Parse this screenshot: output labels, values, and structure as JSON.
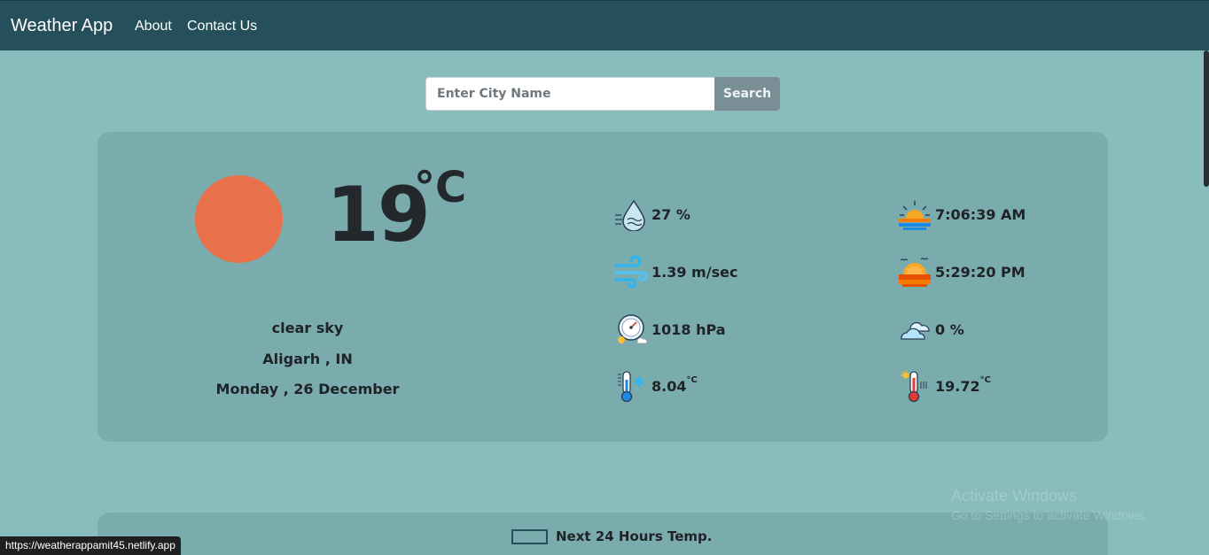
{
  "nav": {
    "brand": "Weather App",
    "links": [
      "About",
      "Contact Us"
    ]
  },
  "search": {
    "placeholder": "Enter City Name",
    "value": "",
    "button_label": "Search"
  },
  "current": {
    "temperature": "19",
    "unit": "°C",
    "description": "clear sky",
    "location": "Aligarh , IN",
    "date": "Monday , 26 December",
    "icon": "sun-icon",
    "icon_color": "#e8704b"
  },
  "stats": {
    "humidity": {
      "value": "27 %",
      "icon": "humidity-icon"
    },
    "sunrise": {
      "value": "7:06:39 AM",
      "icon": "sunrise-icon"
    },
    "wind": {
      "value": "1.39 m/sec",
      "icon": "wind-icon"
    },
    "sunset": {
      "value": "5:29:20 PM",
      "icon": "sunset-icon"
    },
    "pressure": {
      "value": "1018 hPa",
      "icon": "pressure-gauge-icon"
    },
    "clouds": {
      "value": "0 %",
      "icon": "cloud-icon"
    },
    "min_temp": {
      "value": "8.04",
      "unit": "°C",
      "icon": "cold-thermometer-icon"
    },
    "max_temp": {
      "value": "19.72",
      "unit": "°C",
      "icon": "hot-thermometer-icon"
    }
  },
  "forecast": {
    "legend_label": "Next 24 Hours Temp."
  },
  "status_bar": {
    "url": "https://weatherappamit45.netlify.app"
  },
  "watermark": {
    "line1": "Activate Windows",
    "line2": "Go to Settings to activate Windows."
  },
  "colors": {
    "navbar": "#254f5a",
    "page_background": "#89bcbd",
    "card_background": "#7aacad",
    "search_button": "#7a8f95"
  }
}
